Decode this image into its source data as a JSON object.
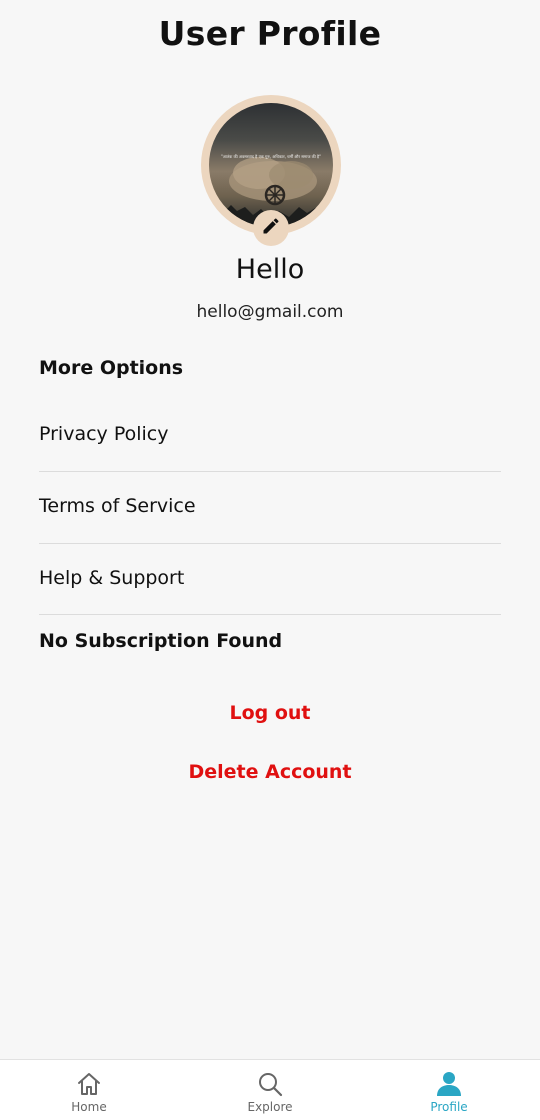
{
  "header": {
    "title": "User Profile"
  },
  "profile": {
    "name": "Hello",
    "email": "hello@gmail.com",
    "avatar_caption": "\"आतंक की अवसरवाद है एक गुरु, अधिकार, धर्मीं और समाज की है\"",
    "edit_icon": "pencil-icon"
  },
  "options": {
    "heading": "More Options",
    "items": [
      {
        "label": "Privacy Policy"
      },
      {
        "label": "Terms of Service"
      },
      {
        "label": "Help & Support"
      }
    ]
  },
  "subscription": {
    "status": "No Subscription Found"
  },
  "actions": {
    "logout": "Log out",
    "delete": "Delete Account",
    "danger_color": "#e01010"
  },
  "bottom_nav": {
    "active_color": "#2aa6c4",
    "items": [
      {
        "label": "Home",
        "icon": "home-icon"
      },
      {
        "label": "Explore",
        "icon": "search-icon"
      },
      {
        "label": "Profile",
        "icon": "person-icon",
        "active": true
      }
    ]
  }
}
